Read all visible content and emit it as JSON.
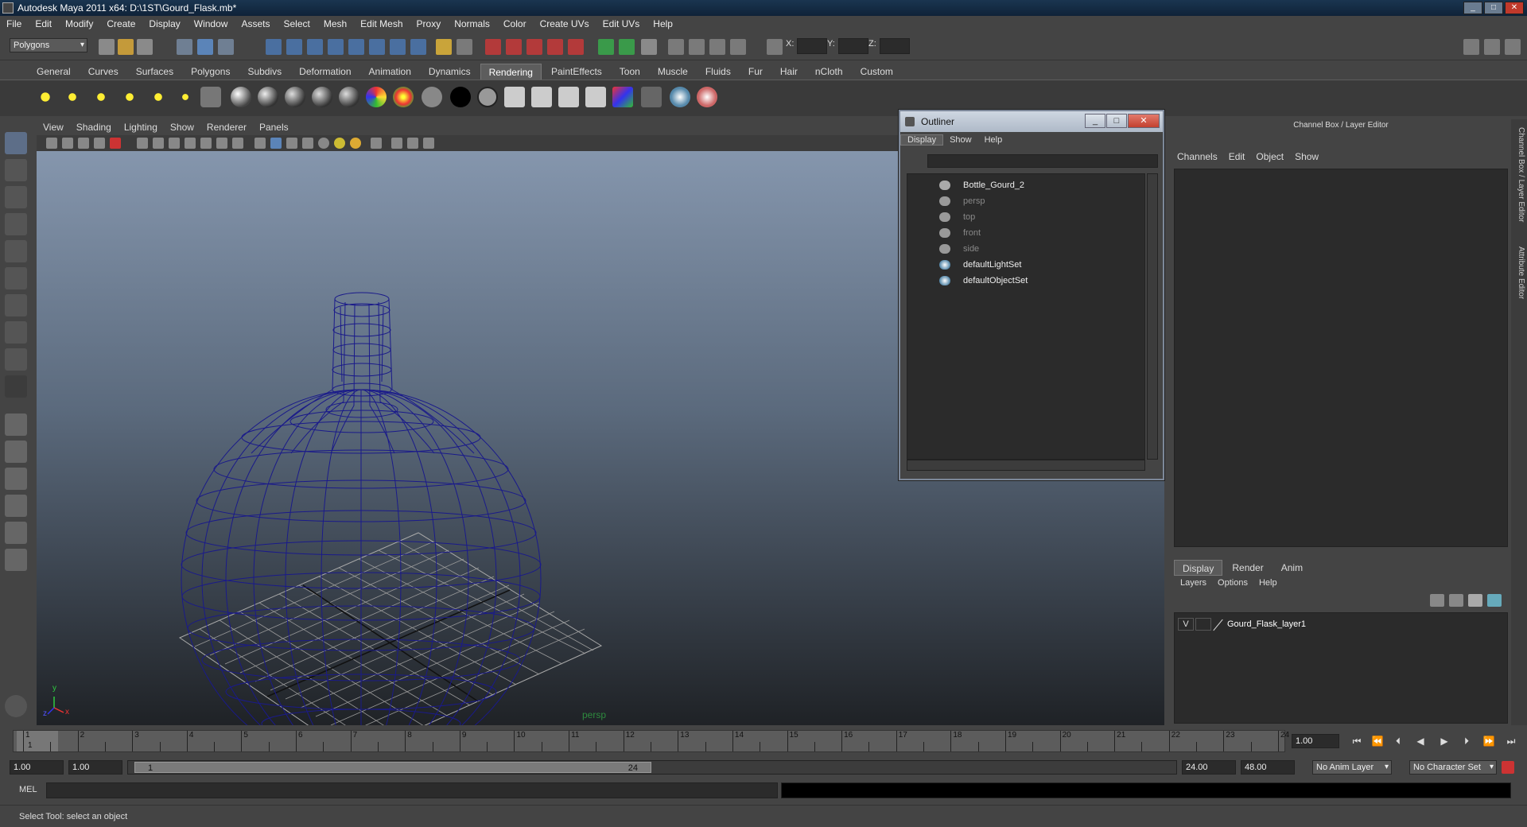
{
  "window": {
    "title": "Autodesk Maya 2011 x64: D:\\1ST\\Gourd_Flask.mb*",
    "min": "_",
    "max": "□",
    "close": "✕"
  },
  "menubar": [
    "File",
    "Edit",
    "Modify",
    "Create",
    "Display",
    "Window",
    "Assets",
    "Select",
    "Mesh",
    "Edit Mesh",
    "Proxy",
    "Normals",
    "Color",
    "Create UVs",
    "Edit UVs",
    "Help"
  ],
  "statusline": {
    "mode": "Polygons",
    "x_label": "X:",
    "y_label": "Y:",
    "z_label": "Z:"
  },
  "shelf": {
    "tabs": [
      "General",
      "Curves",
      "Surfaces",
      "Polygons",
      "Subdivs",
      "Deformation",
      "Animation",
      "Dynamics",
      "Rendering",
      "PaintEffects",
      "Toon",
      "Muscle",
      "Fluids",
      "Fur",
      "Hair",
      "nCloth",
      "Custom"
    ],
    "active": "Rendering"
  },
  "viewport": {
    "menu": [
      "View",
      "Shading",
      "Lighting",
      "Show",
      "Renderer",
      "Panels"
    ],
    "camera_label": "persp",
    "axis_x": "x",
    "axis_y": "y",
    "axis_z": "z"
  },
  "outliner": {
    "title": "Outliner",
    "menu": [
      "Display",
      "Show",
      "Help"
    ],
    "items": [
      {
        "name": "Bottle_Gourd_2",
        "icon": "mesh-transform-icon",
        "dim": false
      },
      {
        "name": "persp",
        "icon": "camera-icon",
        "dim": true
      },
      {
        "name": "top",
        "icon": "camera-icon",
        "dim": true
      },
      {
        "name": "front",
        "icon": "camera-icon",
        "dim": true
      },
      {
        "name": "side",
        "icon": "camera-icon",
        "dim": true
      },
      {
        "name": "defaultLightSet",
        "icon": "set-icon",
        "dim": false
      },
      {
        "name": "defaultObjectSet",
        "icon": "set-icon",
        "dim": false
      }
    ]
  },
  "channelbox": {
    "title": "Channel Box / Layer Editor",
    "menu": [
      "Channels",
      "Edit",
      "Object",
      "Show"
    ],
    "layer_tabs": [
      "Display",
      "Render",
      "Anim"
    ],
    "layer_tab_active": "Display",
    "layer_menu": [
      "Layers",
      "Options",
      "Help"
    ],
    "layer": {
      "visible": "V",
      "name": "Gourd_Flask_layer1"
    }
  },
  "side_tabs": [
    "Channel Box / Layer Editor",
    "Attribute Editor"
  ],
  "timeline": {
    "ticks": [
      "1",
      "2",
      "3",
      "4",
      "5",
      "6",
      "7",
      "8",
      "9",
      "10",
      "11",
      "12",
      "13",
      "14",
      "15",
      "16",
      "17",
      "18",
      "19",
      "20",
      "21",
      "22",
      "23",
      "24"
    ],
    "current_frame": "1.00",
    "current_marker": "1"
  },
  "range": {
    "start": "1.00",
    "playback_start": "1.00",
    "handle_start": "1",
    "handle_end": "24",
    "playback_end": "24.00",
    "end": "48.00",
    "anim_layer": "No Anim Layer",
    "character_set": "No Character Set"
  },
  "cmdline": {
    "label": "MEL"
  },
  "helpline": {
    "text": "Select Tool: select an object"
  },
  "colors": {
    "bg": "#444444",
    "field": "#2b2b2b",
    "wireframe": "#1a1a8a",
    "active_tab": "#5d5d5d"
  }
}
